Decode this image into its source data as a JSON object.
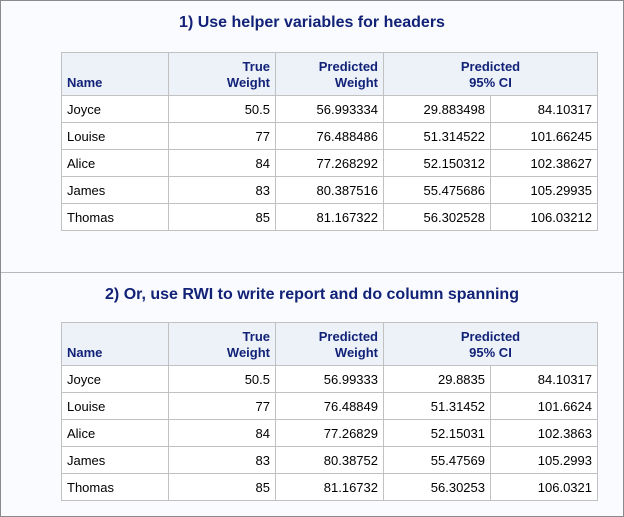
{
  "sections": [
    {
      "title": "1) Use helper variables for headers",
      "headers": {
        "name": "Name",
        "true_line1": "True",
        "true_line2": "Weight",
        "pred_line1": "Predicted",
        "pred_line2": "Weight",
        "ci_line1": "Predicted",
        "ci_line2": "95% CI"
      },
      "rows": [
        {
          "name": "Joyce",
          "true": "50.5",
          "pred": "56.993334",
          "lo": "29.883498",
          "hi": "84.10317"
        },
        {
          "name": "Louise",
          "true": "77",
          "pred": "76.488486",
          "lo": "51.314522",
          "hi": "101.66245"
        },
        {
          "name": "Alice",
          "true": "84",
          "pred": "77.268292",
          "lo": "52.150312",
          "hi": "102.38627"
        },
        {
          "name": "James",
          "true": "83",
          "pred": "80.387516",
          "lo": "55.475686",
          "hi": "105.29935"
        },
        {
          "name": "Thomas",
          "true": "85",
          "pred": "81.167322",
          "lo": "56.302528",
          "hi": "106.03212"
        }
      ]
    },
    {
      "title": "2) Or, use RWI to write report and do column spanning",
      "headers": {
        "name": "Name",
        "true_line1": "True",
        "true_line2": "Weight",
        "pred_line1": "Predicted",
        "pred_line2": "Weight",
        "ci_line1": "Predicted",
        "ci_line2": "95% CI"
      },
      "rows": [
        {
          "name": "Joyce",
          "true": "50.5",
          "pred": "56.99333",
          "lo": "29.8835",
          "hi": "84.10317"
        },
        {
          "name": "Louise",
          "true": "77",
          "pred": "76.48849",
          "lo": "51.31452",
          "hi": "101.6624"
        },
        {
          "name": "Alice",
          "true": "84",
          "pred": "77.26829",
          "lo": "52.15031",
          "hi": "102.3863"
        },
        {
          "name": "James",
          "true": "83",
          "pred": "80.38752",
          "lo": "55.47569",
          "hi": "105.2993"
        },
        {
          "name": "Thomas",
          "true": "85",
          "pred": "81.16732",
          "lo": "56.30253",
          "hi": "106.0321"
        }
      ]
    }
  ]
}
